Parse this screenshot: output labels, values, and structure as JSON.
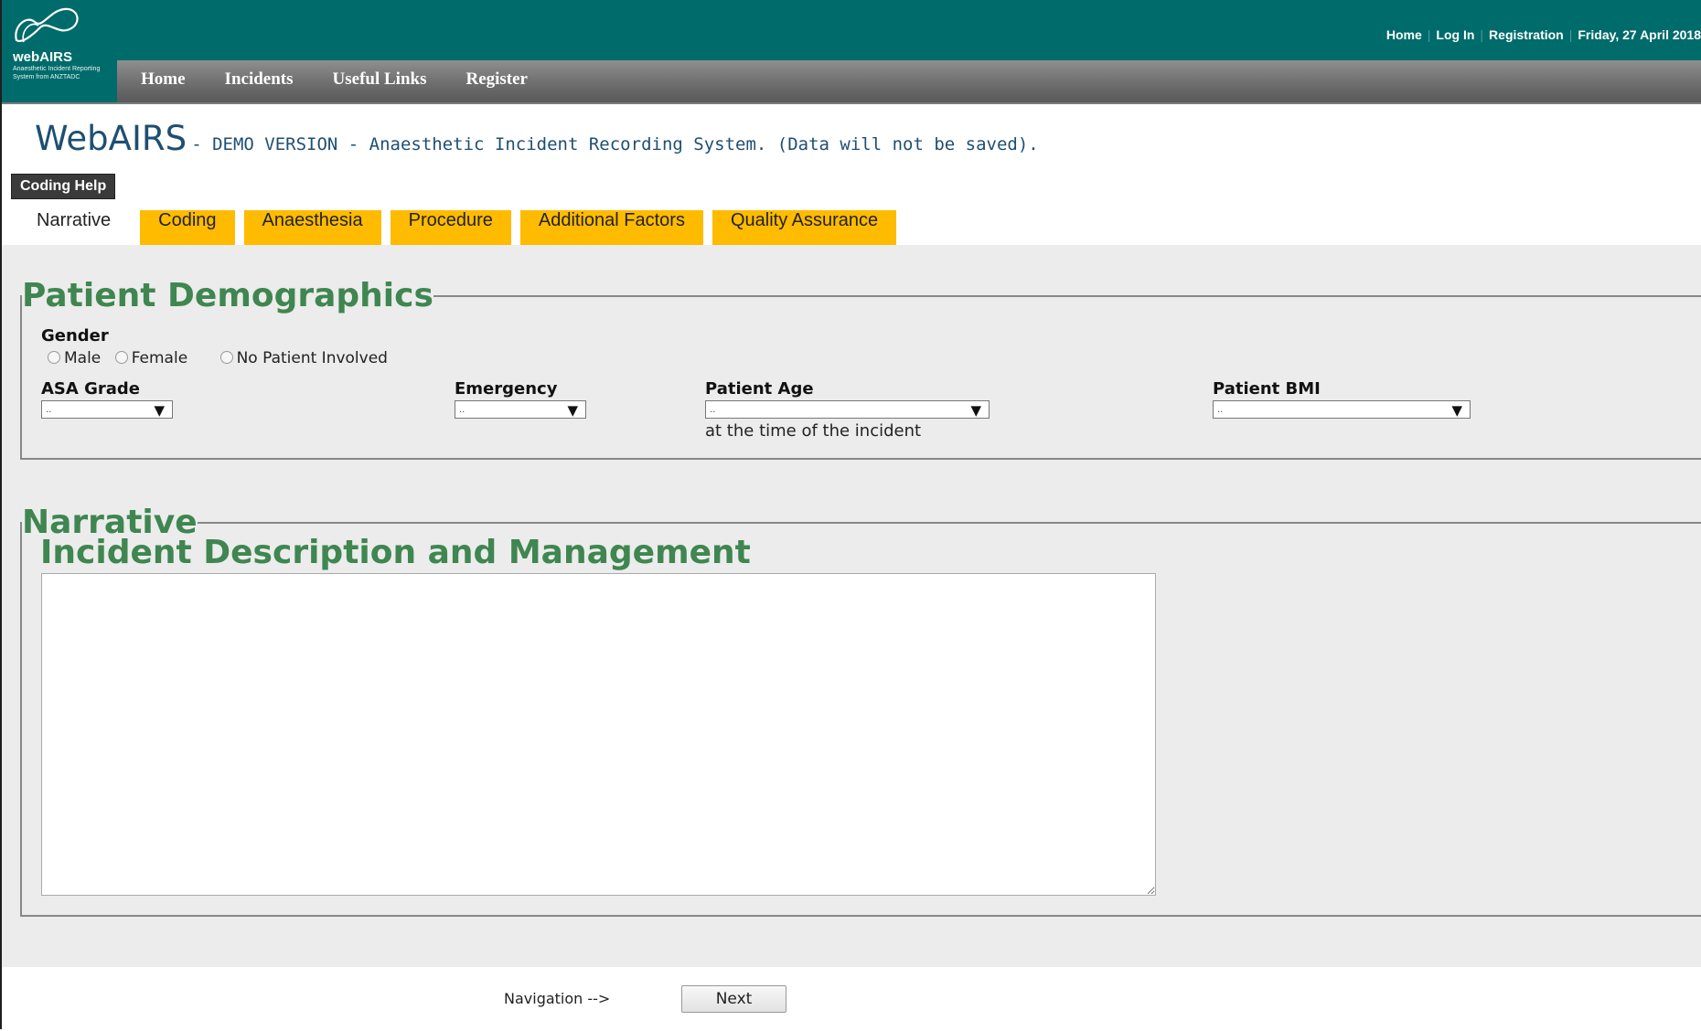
{
  "header": {
    "logo": {
      "brand": "webAIRS",
      "tagline": "Anaesthetic Incident Reporting System from ANZTADC"
    },
    "top_links": [
      "Home",
      "Log In",
      "Registration"
    ],
    "date": "Friday, 27 April 2018",
    "nav": [
      "Home",
      "Incidents",
      "Useful Links",
      "Register"
    ]
  },
  "page": {
    "title": "WebAIRS",
    "subtitle": "- DEMO VERSION - Anaesthetic Incident Recording System. (Data will not be saved).",
    "coding_help": "Coding Help"
  },
  "tabs": [
    {
      "label": "Narrative",
      "active": true
    },
    {
      "label": "Coding",
      "active": false
    },
    {
      "label": "Anaesthesia",
      "active": false
    },
    {
      "label": "Procedure",
      "active": false
    },
    {
      "label": "Additional Factors",
      "active": false
    },
    {
      "label": "Quality Assurance",
      "active": false
    }
  ],
  "demographics": {
    "legend": "Patient Demographics",
    "gender_label": "Gender",
    "gender_options": [
      "Male",
      "Female",
      "No Patient Involved"
    ],
    "asa_label": "ASA Grade",
    "asa_value": "..",
    "emergency_label": "Emergency",
    "emergency_value": "..",
    "age_label": "Patient Age",
    "age_value": "..",
    "age_note": "at the time of the incident",
    "bmi_label": "Patient BMI",
    "bmi_value": ".."
  },
  "narrative": {
    "legend": "Narrative",
    "heading": "Incident Description and Management",
    "text": ""
  },
  "navigation": {
    "label": "Navigation -->",
    "next": "Next"
  },
  "colors": {
    "header_teal": "#006b6b",
    "tab_orange": "#ffbb00",
    "heading_green": "#3f8650",
    "title_blue": "#1e4f72"
  }
}
